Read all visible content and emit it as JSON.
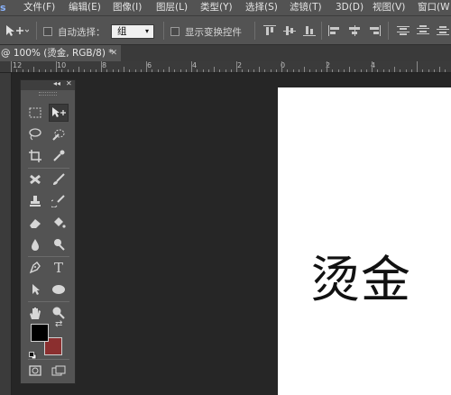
{
  "menubar": {
    "app_logo": "s",
    "items": [
      "文件(F)",
      "编辑(E)",
      "图像(I)",
      "图层(L)",
      "类型(Y)",
      "选择(S)",
      "滤镜(T)",
      "3D(D)",
      "视图(V)",
      "窗口(W"
    ]
  },
  "options": {
    "auto_select_label": "自动选择：",
    "auto_select_value": "组",
    "show_transform_label": "显示变换控件"
  },
  "document": {
    "tab_title": "@ 100% (烫金, RGB/8) *",
    "canvas_text": "烫金"
  },
  "ruler": {
    "labels": [
      "12",
      "10",
      "8",
      "6",
      "4",
      "2",
      "0",
      "2",
      "4"
    ]
  },
  "tools_panel": {
    "collapse_glyph": "◂◂",
    "close_glyph": "✕"
  },
  "colors": {
    "foreground": "#000000",
    "background": "#8b2f2f"
  }
}
